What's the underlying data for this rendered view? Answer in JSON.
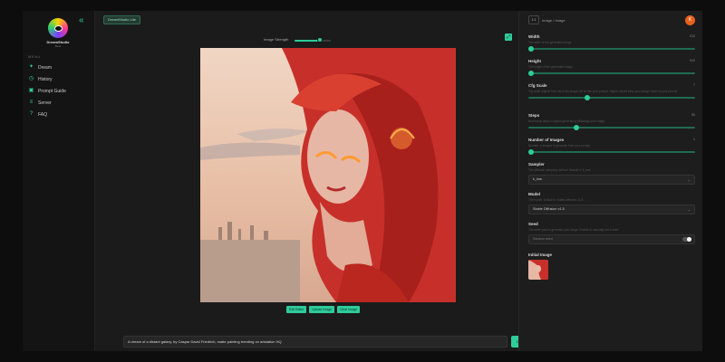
{
  "app": {
    "name": "DreamStudio",
    "subtitle": "Beta",
    "tag": "DreamStudio Lite"
  },
  "sidebar": {
    "menu_heading": "MENU",
    "items": [
      {
        "label": "Dream",
        "icon": "sparkle-icon"
      },
      {
        "label": "History",
        "icon": "history-icon"
      },
      {
        "label": "Prompt Guide",
        "icon": "image-guide-icon"
      },
      {
        "label": "Server",
        "icon": "server-icon"
      },
      {
        "label": "FAQ",
        "icon": "question-icon"
      }
    ]
  },
  "main": {
    "image_strength_label": "Image Strength",
    "image_strength_value": 0.7,
    "art_buttons": [
      "Edit Editor",
      "Upload Image",
      "Clear Image"
    ],
    "prompt": "A dream of a distant galaxy, by Caspar David Friedrich, matte painting trending on artstation HQ",
    "dream_label": "Dream"
  },
  "panel": {
    "toggle": "1:1",
    "top_label": "Image / Image",
    "avatar_initial": "K",
    "width": {
      "label": "Width",
      "desc": "The width of the generated image",
      "value": "512",
      "level": 0.0
    },
    "height": {
      "label": "Height",
      "desc": "The height of the generated image",
      "value": "512",
      "level": 0.0
    },
    "cfg": {
      "label": "Cfg Scale",
      "desc": "Cfg scale adjusts how much the image will be like your prompt. Higher values keep your image closer to your prompt.",
      "value": "7",
      "level": 0.35
    },
    "steps": {
      "label": "Steps",
      "desc": "How many steps to spend generating (diffusing) your image.",
      "value": "50",
      "level": 0.28
    },
    "num_images": {
      "label": "Number of Images",
      "desc": "Number of images to generate from your prompt.",
      "value": "1",
      "level": 0.0
    },
    "sampler": {
      "label": "Sampler",
      "desc": "The diffusion sampling method. Default is 'k_lms'.",
      "value": "k_lms"
    },
    "model": {
      "label": "Model",
      "desc": "The model. Default is 'stable-diffusion-v1-5'.",
      "value": "Stable Diffusion v1.5"
    },
    "seed": {
      "label": "Seed",
      "desc": "The seed used to generate your image. Enable to manually set a seed.",
      "placeholder": "Random seed"
    },
    "init_image": {
      "label": "Initial Image"
    }
  }
}
